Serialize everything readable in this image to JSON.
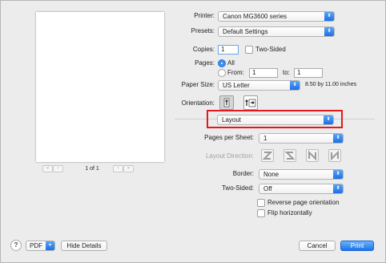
{
  "printer": {
    "label": "Printer:",
    "value": "Canon MG3600 series"
  },
  "presets": {
    "label": "Presets:",
    "value": "Default Settings"
  },
  "copies": {
    "label": "Copies:",
    "value": "1",
    "two_sided_label": "Two-Sided"
  },
  "pages": {
    "label": "Pages:",
    "all_label": "All",
    "from_label": "From:",
    "from_value": "1",
    "to_label": "to:",
    "to_value": "1"
  },
  "paper_size": {
    "label": "Paper Size:",
    "value": "US Letter",
    "dimensions": "8.50 by 11.00 inches"
  },
  "orientation": {
    "label": "Orientation:"
  },
  "section": {
    "value": "Layout"
  },
  "pages_per_sheet": {
    "label": "Pages per Sheet:",
    "value": "1"
  },
  "layout_direction": {
    "label": "Layout Direction:"
  },
  "border": {
    "label": "Border:",
    "value": "None"
  },
  "two_sided": {
    "label": "Two-Sided:",
    "value": "Off"
  },
  "reverse_orientation": {
    "label": "Reverse page orientation"
  },
  "flip_horizontally": {
    "label": "Flip horizontally"
  },
  "preview": {
    "page_count": "1 of 1"
  },
  "footer": {
    "help": "?",
    "pdf": "PDF",
    "hide_details": "Hide Details",
    "cancel": "Cancel",
    "print": "Print"
  }
}
